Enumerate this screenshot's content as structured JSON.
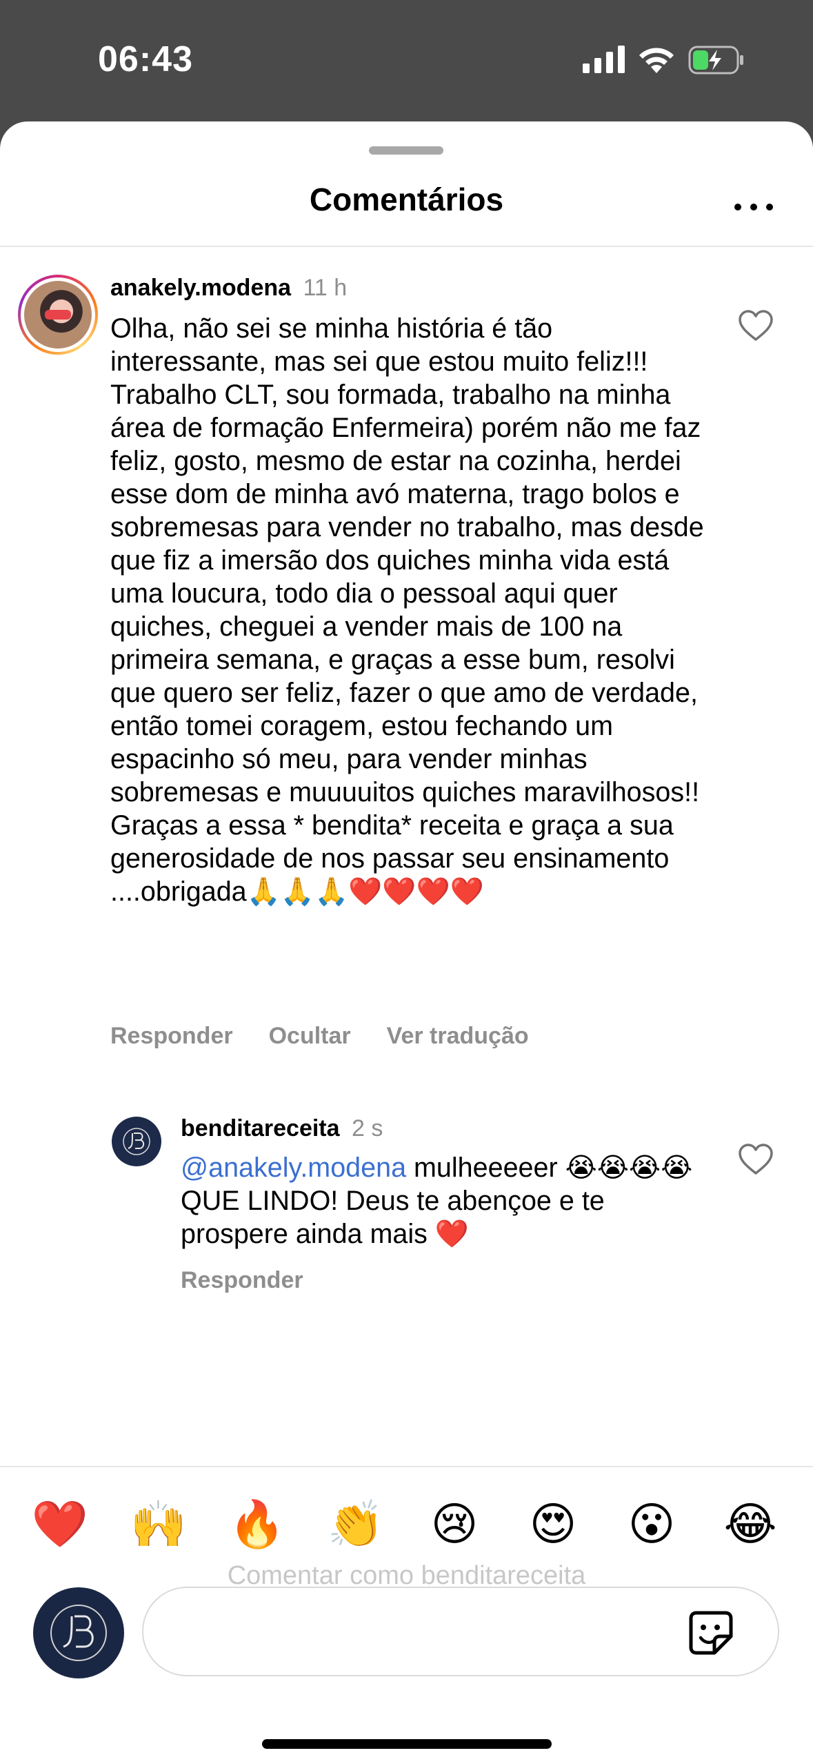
{
  "status_bar": {
    "time": "06:43",
    "icons": [
      "cellular-signal-icon",
      "wifi-icon",
      "battery-charging-icon"
    ]
  },
  "sheet": {
    "title": "Comentários",
    "menu_icon": "more-horizontal-icon"
  },
  "comment": {
    "username": "anakely.modena",
    "timestamp": "11 h",
    "text": "Olha, não sei se minha história é tão interessante, mas sei que estou muito feliz!!! Trabalho CLT, sou formada, trabalho na minha área de formação Enfermeira) porém não me faz feliz, gosto, mesmo de estar na cozinha, herdei esse dom de minha avó materna, trago bolos e sobremesas para vender no trabalho,  mas desde que fiz a imersão dos quiches minha vida está uma loucura, todo dia o pessoal aqui quer quiches, cheguei a vender mais de 100 na primeira semana, e graças a esse bum, resolvi que quero ser feliz, fazer o que amo de verdade, então tomei coragem, estou fechando um espacinho só meu, para vender minhas sobremesas e muuuuitos quiches maravilhosos!! Graças a essa * bendita* receita e graça a sua generosidade de nos passar seu ensinamento ....obrigada🙏🙏🙏❤️❤️❤️❤️",
    "actions": {
      "reply": "Responder",
      "hide": "Ocultar",
      "translate": "Ver tradução"
    },
    "like_icon": "heart-outline-icon"
  },
  "reply": {
    "username": "benditareceita",
    "timestamp": "2 s",
    "mention": "@anakely.modena",
    "text": " mulheeeeer 😭😭😭😭 QUE LINDO! Deus te abençoe e te prospere ainda mais ❤️",
    "actions": {
      "reply": "Responder"
    },
    "like_icon": "heart-outline-icon"
  },
  "composer": {
    "quick_emojis": [
      "❤️",
      "🙌",
      "🔥",
      "👏",
      "😢",
      "😍",
      "😮",
      "😂"
    ],
    "comment_as": "Comentar como benditareceita",
    "sticker_icon": "sticker-icon"
  },
  "colors": {
    "mention": "#3b6fd1",
    "secondary_text": "#8e8e8e",
    "status_bar_bg": "#4a4a4a",
    "battery_charge": "#4cd964"
  }
}
